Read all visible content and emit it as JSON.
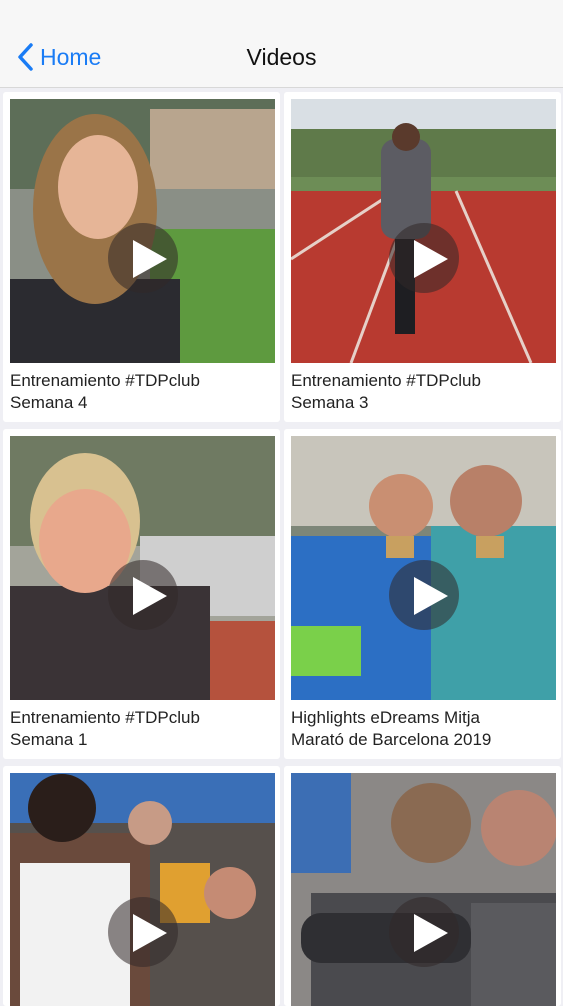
{
  "navbar": {
    "back_label": "Home",
    "title": "Videos"
  },
  "videos": [
    {
      "line1": "Entrenamiento #TDPclub",
      "line2": "Semana 4"
    },
    {
      "line1": "Entrenamiento #TDPclub",
      "line2": "Semana 3"
    },
    {
      "line1": "Entrenamiento #TDPclub",
      "line2": "Semana 1"
    },
    {
      "line1": "Highlights eDreams Mitja",
      "line2": "Marató de Barcelona 2019"
    },
    {
      "line1": "",
      "line2": ""
    },
    {
      "line1": "",
      "line2": ""
    }
  ],
  "colors": {
    "accent": "#1a7cf5",
    "background": "#efeff4"
  }
}
